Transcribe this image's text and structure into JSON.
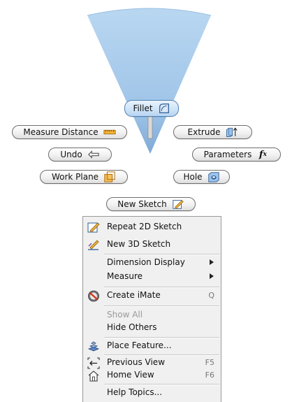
{
  "marking_menu": {
    "fillet": "Fillet",
    "measure_distance": "Measure Distance",
    "extrude": "Extrude",
    "undo": "Undo",
    "parameters": "Parameters",
    "parameters_symbol": "f",
    "parameters_symbol_sub": "x",
    "work_plane": "Work Plane",
    "hole": "Hole",
    "new_sketch": "New Sketch"
  },
  "context_menu": {
    "items": [
      {
        "label": "Repeat 2D Sketch",
        "icon": "sketch-pencil-icon"
      },
      {
        "label": "New 3D Sketch",
        "icon": "3d-sketch-pencil-icon"
      },
      {
        "label": "Dimension Display",
        "submenu": true
      },
      {
        "label": "Measure",
        "submenu": true
      },
      {
        "label": "Create iMate",
        "icon": "imate-icon",
        "shortcut": "Q"
      },
      {
        "label": "Show All",
        "disabled": true
      },
      {
        "label": "Hide Others"
      },
      {
        "label": "Place Feature...",
        "icon": "place-feature-icon"
      },
      {
        "label": "Previous View",
        "icon": "previous-view-icon",
        "shortcut": "F5"
      },
      {
        "label": "Home View",
        "icon": "home-view-icon",
        "shortcut": "F6"
      },
      {
        "label": "Help Topics..."
      }
    ]
  },
  "colors": {
    "wedge": "#a6c9ea",
    "active_pill": "#cfe4f8",
    "menu_bg": "#f0f0f0"
  }
}
